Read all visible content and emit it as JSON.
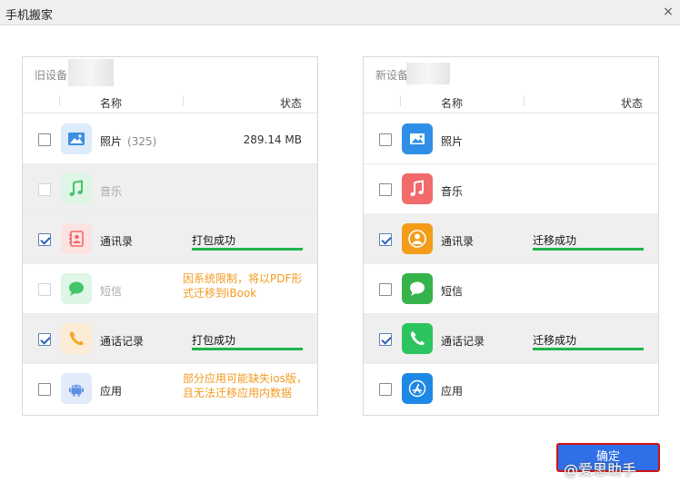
{
  "window": {
    "title": "手机搬家",
    "close_glyph": "×"
  },
  "old_device": {
    "label": "旧设备",
    "columns": {
      "name": "名称",
      "status": "状态"
    },
    "rows": [
      {
        "name": "照片",
        "count": "(325)",
        "size": "289.14 MB",
        "checked": false,
        "disabled": false,
        "icon": "photos-icon",
        "status": "",
        "note": ""
      },
      {
        "name": "音乐",
        "checked": false,
        "disabled": true,
        "icon": "music-icon",
        "status": "",
        "note": ""
      },
      {
        "name": "通讯录",
        "checked": true,
        "disabled": false,
        "icon": "contacts-icon",
        "status": "打包成功",
        "progress": 1.0,
        "note": ""
      },
      {
        "name": "短信",
        "checked": false,
        "disabled": true,
        "icon": "messages-icon",
        "status": "",
        "note": "因系统限制，将以PDF形式迁移到iBook"
      },
      {
        "name": "通话记录",
        "checked": true,
        "disabled": false,
        "icon": "phone-icon",
        "status": "打包成功",
        "progress": 1.0,
        "note": ""
      },
      {
        "name": "应用",
        "checked": false,
        "disabled": false,
        "icon": "android-icon",
        "status": "",
        "note": "部分应用可能缺失ios版，且无法迁移应用内数据"
      }
    ]
  },
  "new_device": {
    "label": "新设备",
    "columns": {
      "name": "名称",
      "status": "状态"
    },
    "rows": [
      {
        "name": "照片",
        "checked": false,
        "icon": "photos-icon",
        "status": ""
      },
      {
        "name": "音乐",
        "checked": false,
        "icon": "music-icon",
        "status": ""
      },
      {
        "name": "通讯录",
        "checked": true,
        "icon": "contacts-icon",
        "status": "迁移成功",
        "progress": 1.0
      },
      {
        "name": "短信",
        "checked": false,
        "icon": "messages-icon",
        "status": ""
      },
      {
        "name": "通话记录",
        "checked": true,
        "icon": "phone-icon",
        "status": "迁移成功",
        "progress": 1.0
      },
      {
        "name": "应用",
        "checked": false,
        "icon": "app-store-icon",
        "status": ""
      }
    ]
  },
  "actions": {
    "confirm_label": "确定"
  },
  "watermark": "@爱思助手",
  "colors": {
    "accent": "#2f6fe8",
    "success": "#1fb54b",
    "warning": "#f39a1f",
    "highlight_border": "#d31111"
  }
}
